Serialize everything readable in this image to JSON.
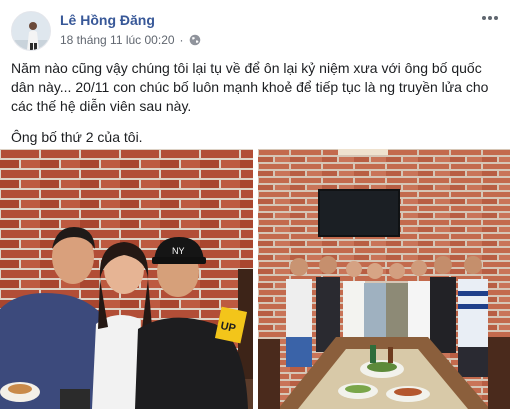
{
  "post": {
    "author": "Lê Hồng Đăng",
    "timestamp": "18 tháng 11 lúc 00:20",
    "privacy_icon": "globe-icon",
    "more_icon": "more-dots-icon",
    "paragraphs": [
      "Năm nào cũng vậy chúng tôi lại tụ về để ôn lại kỷ niệm xưa với ông bố quốc dân này... 20/11 con chúc bố luôn mạnh khoẻ để tiếp tục là ng truyền lửa cho các thế hệ diễn viên sau này.",
      "Ông bố thứ 2 của tôi."
    ]
  },
  "photos": {
    "left": {
      "cap_text": "NY",
      "shirt_text": "UP"
    }
  },
  "colors": {
    "author_link": "#385898",
    "meta_text": "#616770",
    "brick": "#b5533c"
  }
}
